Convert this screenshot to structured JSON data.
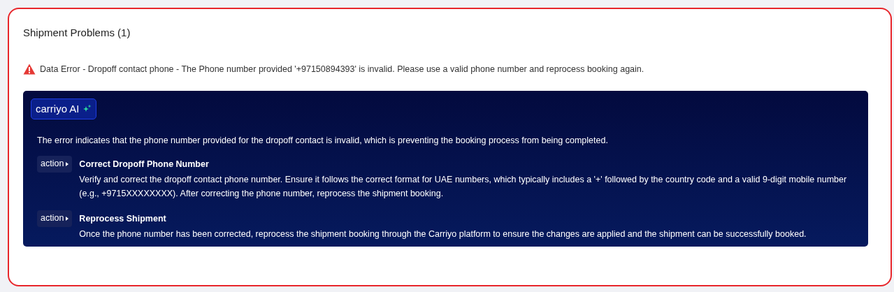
{
  "panel": {
    "title": "Shipment Problems (1)"
  },
  "error": {
    "message": "Data Error - Dropoff contact phone - The Phone number provided '+97150894393' is invalid. Please use a valid phone number and reprocess booking again."
  },
  "ai": {
    "badge": "carriyo AI",
    "summary": "The error indicates that the phone number provided for the dropoff contact is invalid, which is preventing the booking process from being completed.",
    "actions": [
      {
        "tag": "action",
        "title": "Correct Dropoff Phone Number",
        "description": "Verify and correct the dropoff contact phone number. Ensure it follows the correct format for UAE numbers, which typically includes a '+' followed by the country code and a valid 9-digit mobile number (e.g., +9715XXXXXXXX). After correcting the phone number, reprocess the shipment booking."
      },
      {
        "tag": "action",
        "title": "Reprocess Shipment",
        "description": "Once the phone number has been corrected, reprocess the shipment booking through the Carriyo platform to ensure the changes are applied and the shipment can be successfully booked."
      }
    ]
  }
}
